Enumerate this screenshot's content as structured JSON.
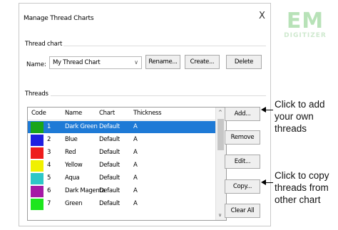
{
  "dialog": {
    "title": "Manage Thread Charts",
    "close_glyph": "X",
    "thread_chart_group": "Thread chart",
    "name_label": "Name:",
    "name_value": "My Thread Chart",
    "rename_label": "Rename...",
    "create_label": "Create...",
    "delete_label": "Delete",
    "threads_group": "Threads",
    "columns": {
      "code": "Code",
      "name": "Name",
      "chart": "Chart",
      "thickness": "Thickness"
    },
    "rows": [
      {
        "code": "1",
        "color": "#1aa51a",
        "name": "Dark Green",
        "chart": "Default",
        "thickness": "A",
        "selected": true
      },
      {
        "code": "2",
        "color": "#1f1fe0",
        "name": "Blue",
        "chart": "Default",
        "thickness": "A",
        "selected": false
      },
      {
        "code": "3",
        "color": "#ee1c1c",
        "name": "Red",
        "chart": "Default",
        "thickness": "A",
        "selected": false
      },
      {
        "code": "4",
        "color": "#f0f000",
        "name": "Yellow",
        "chart": "Default",
        "thickness": "A",
        "selected": false
      },
      {
        "code": "5",
        "color": "#2ec7c7",
        "name": "Aqua",
        "chart": "Default",
        "thickness": "A",
        "selected": false
      },
      {
        "code": "6",
        "color": "#a51aa5",
        "name": "Dark Magenta",
        "chart": "Default",
        "thickness": "A",
        "selected": false
      },
      {
        "code": "7",
        "color": "#1ee61e",
        "name": "Green",
        "chart": "Default",
        "thickness": "A",
        "selected": false
      }
    ],
    "buttons": {
      "add": "Add...",
      "remove": "Remove",
      "edit": "Edit...",
      "copy": "Copy...",
      "clear_all": "Clear All"
    }
  },
  "logo": {
    "primary": "EM",
    "secondary": "DIGITIZER"
  },
  "callouts": {
    "add": [
      "Click to add",
      "your own",
      "threads"
    ],
    "copy": [
      "Click to copy",
      "threads from",
      "other chart"
    ]
  },
  "colors": {
    "selection": "#1e7ad6",
    "logo": "#b8e2b8"
  }
}
